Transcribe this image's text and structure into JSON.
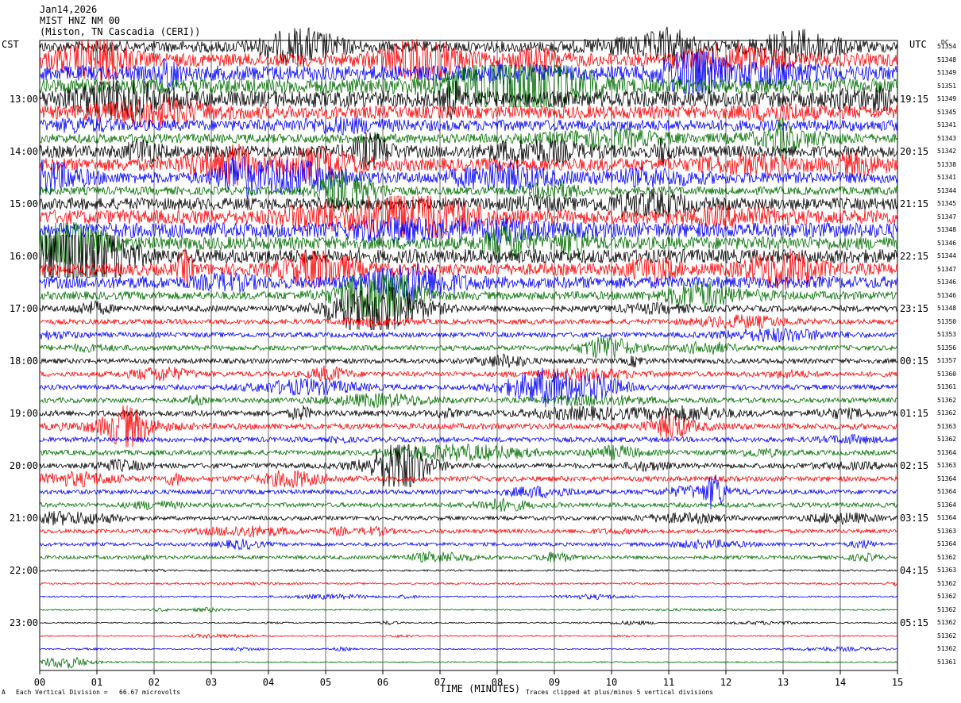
{
  "header": {
    "date": "Jan14,2026",
    "channel": "MIST HNZ NM 00",
    "location": "(Miston, TN Cascadia (CERI))"
  },
  "left_axis_label": "CST",
  "right_axis_label": "UTC",
  "dc_header": "DC",
  "footer": {
    "scale": "Each Vertical Division =   66.67 microvolts",
    "clip_note": "Traces clipped at plus/minus 5 vertical divisions",
    "corner_mark": "A"
  },
  "colors": {
    "trace_cycle": [
      "#000000",
      "#ff0000",
      "#0000ff",
      "#007000"
    ],
    "grid": "#000000"
  },
  "chart_data": {
    "type": "line",
    "title": "",
    "xlabel": "TIME (MINUTES)",
    "xlim": [
      0,
      15
    ],
    "x_ticks": [
      "00",
      "01",
      "02",
      "03",
      "04",
      "05",
      "06",
      "07",
      "08",
      "09",
      "10",
      "11",
      "12",
      "13",
      "14",
      "15"
    ],
    "trace_count": 48,
    "minutes_per_trace": 15,
    "left_hour_labels": [
      "13:00",
      "14:00",
      "15:00",
      "16:00",
      "17:00",
      "18:00",
      "19:00",
      "20:00",
      "21:00",
      "22:00",
      "23:00"
    ],
    "right_hour_labels": [
      "19:15",
      "20:15",
      "21:15",
      "22:15",
      "23:15",
      "00:15",
      "01:15",
      "02:15",
      "03:15",
      "04:15",
      "05:15"
    ],
    "hour_label_first_trace": 4,
    "dc_offsets": [
      51354,
      51348,
      51349,
      51351,
      51349,
      51345,
      51341,
      51343,
      51342,
      51338,
      51341,
      51344,
      51345,
      51347,
      51348,
      51346,
      51344,
      51347,
      51346,
      51346,
      51348,
      51350,
      51353,
      51356,
      51357,
      51360,
      51361,
      51362,
      51362,
      51363,
      51362,
      51364,
      51363,
      51364,
      51364,
      51364,
      51364,
      51363,
      51364,
      51362,
      51363,
      51362,
      51362,
      51362,
      51362,
      51362,
      51362,
      51361
    ],
    "relative_amplitude": [
      2.2,
      2.6,
      3.0,
      3.0,
      3.2,
      2.6,
      2.2,
      1.8,
      2.4,
      2.6,
      2.2,
      1.6,
      2.4,
      2.8,
      3.0,
      2.6,
      2.8,
      2.4,
      2.4,
      1.6,
      1.2,
      1.0,
      1.0,
      1.0,
      1.0,
      1.0,
      1.0,
      1.0,
      1.2,
      1.2,
      1.0,
      1.0,
      1.0,
      1.0,
      0.9,
      0.9,
      0.8,
      0.8,
      0.7,
      0.7,
      0.35,
      0.35,
      0.3,
      0.25,
      0.25,
      0.25,
      0.25,
      0.25
    ]
  }
}
